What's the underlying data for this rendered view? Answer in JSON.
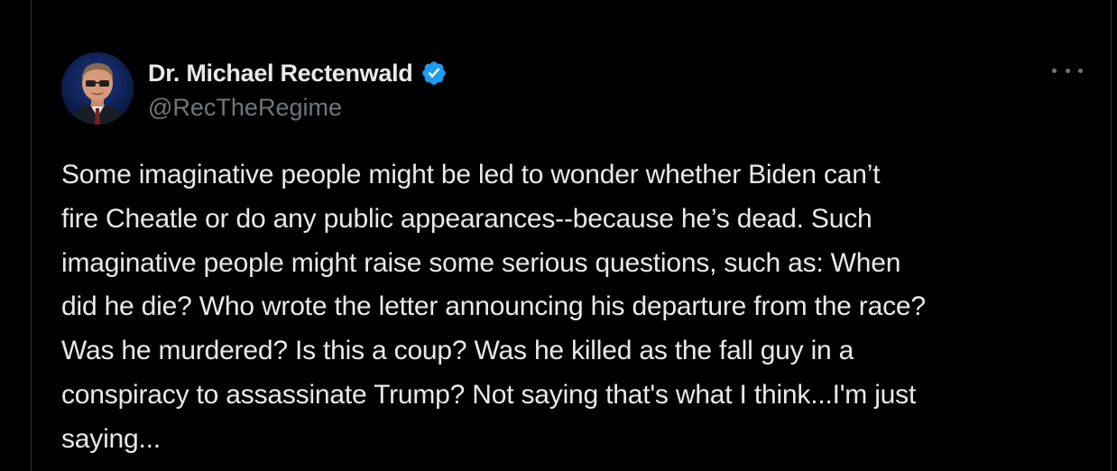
{
  "tweet": {
    "display_name": "Dr. Michael Rectenwald",
    "handle": "@RecTheRegime",
    "verified": true,
    "text": "Some imaginative people might be led to wonder whether Biden can’t\nfire Cheatle or do any public appearances--because he’s dead. Such\nimaginative people might raise some serious questions, such as: When\ndid he die? Who wrote the letter announcing his departure from the race?\nWas he murdered? Is this a coup? Was he killed as the fall guy in a\nconspiracy to assassinate Trump? Not saying that's what I think...I'm just\nsaying..."
  },
  "icons": {
    "avatar": "profile-photo",
    "verified": "verified-badge-icon",
    "more": "more-options-icon"
  },
  "colors": {
    "background": "#000000",
    "primary_text": "#e7e9ea",
    "secondary_text": "#71767b",
    "verified_blue": "#1d9bf0",
    "border": "#2f3336"
  }
}
